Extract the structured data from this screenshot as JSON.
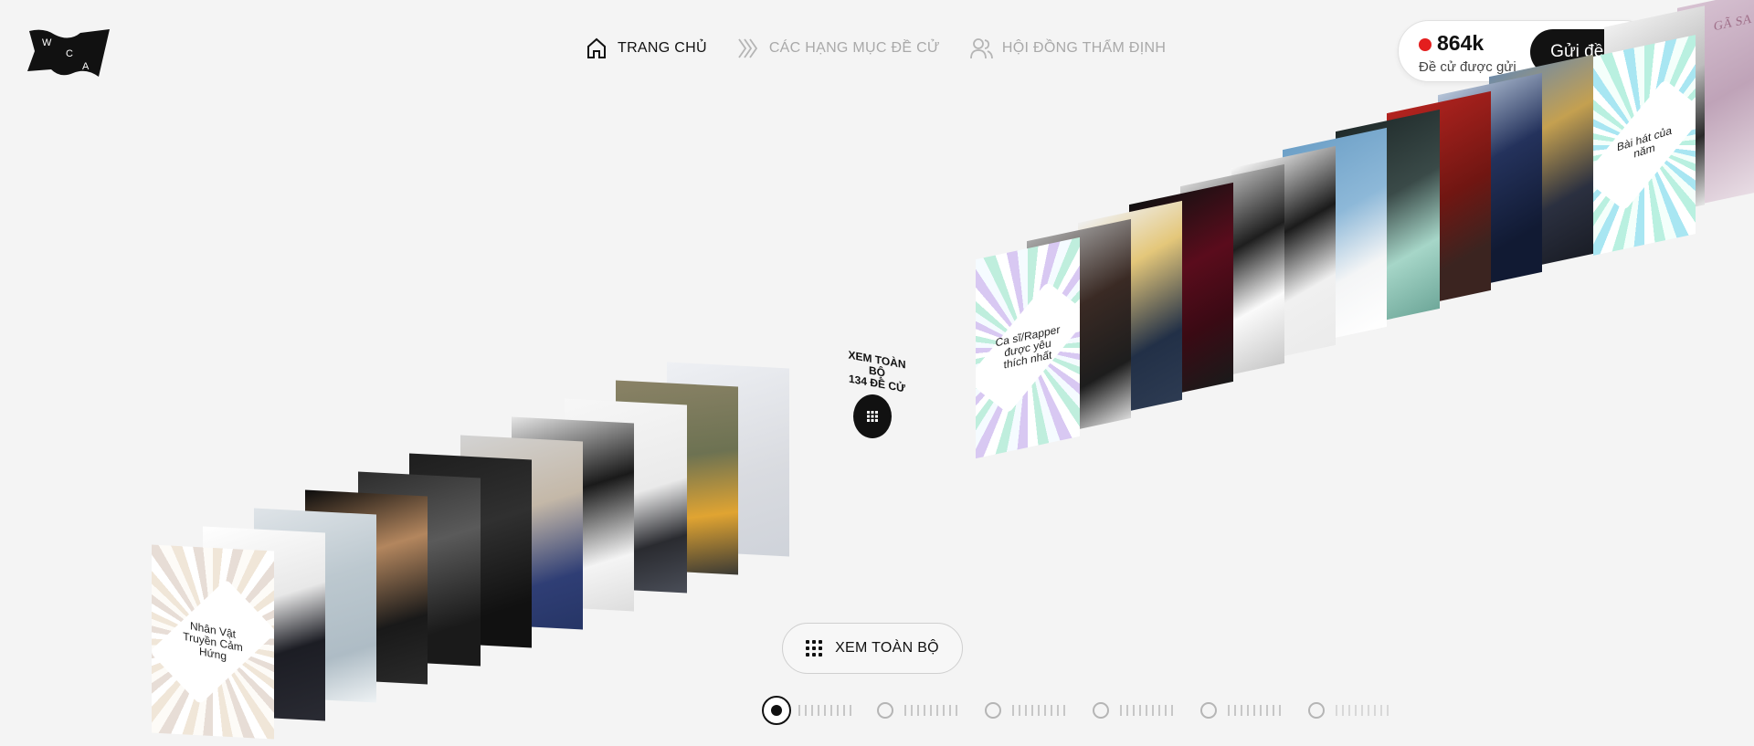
{
  "logo": {
    "letters": [
      "W",
      "C",
      "A"
    ]
  },
  "nav": {
    "items": [
      {
        "label": "TRANG CHỦ",
        "icon": "home-icon"
      },
      {
        "label": "CÁC HẠNG MỤC ĐỀ CỬ",
        "icon": "chevrons-icon"
      },
      {
        "label": "HỘI ĐỒNG THẨM ĐỊNH",
        "icon": "people-icon"
      }
    ]
  },
  "counter": {
    "value": "864k",
    "label": "Đề cử được gửi"
  },
  "submit_button": "Gửi đề cử",
  "center": {
    "line1": "XEM TOÀN BỘ",
    "line2": "134 ĐỀ CỬ"
  },
  "view_all_button": "XEM TOÀN BỘ",
  "category_tiles": [
    {
      "label": "Nhân Vật Truyền Cảm Hứng"
    },
    {
      "label": "Ca sĩ/Rapper được yêu thích nhất"
    },
    {
      "label": "Bài hát của năm"
    }
  ],
  "corner_text": "GÃ SA",
  "pagination": {
    "pages": 6,
    "active": 0
  },
  "colors": {
    "accent_red": "#e41e1e",
    "dark": "#121212",
    "background": "#f4f4f4"
  }
}
